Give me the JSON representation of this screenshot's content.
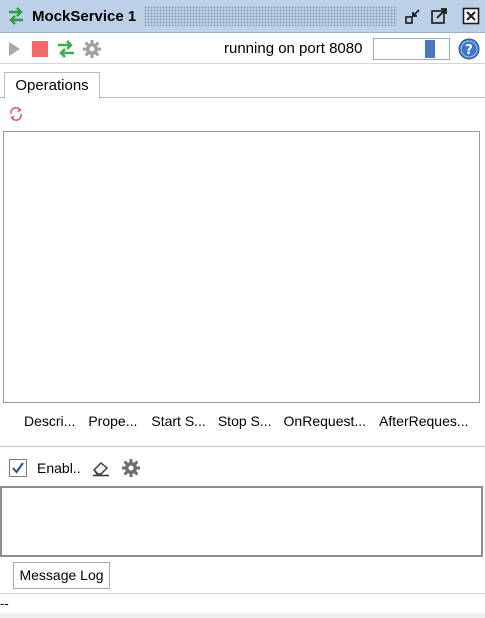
{
  "window": {
    "title": "MockService 1",
    "icons": {
      "service": "mockservice-icon",
      "minimize": "minimize-icon",
      "maximize": "maximize-icon",
      "close": "close-icon"
    }
  },
  "toolbar": {
    "icons": [
      "play-icon",
      "stop-icon",
      "swap-arrows-icon",
      "gear-icon"
    ],
    "status": "running on port 8080",
    "help_icon": "help-icon"
  },
  "tabs": {
    "operations": "Operations"
  },
  "operations": {
    "columns": [
      "Descri...",
      "Prope...",
      "Start S...",
      "Stop S...",
      "OnRequest...",
      "AfterReques..."
    ]
  },
  "log": {
    "enable_label": "Enabl..",
    "enabled": true,
    "tab": "Message Log"
  },
  "statusbar": {
    "text": "--"
  },
  "colors": {
    "titlebar": "#bcd0e8",
    "accent": "#4a77c0",
    "stop": "#f0686a",
    "run": "#3bb14a"
  }
}
